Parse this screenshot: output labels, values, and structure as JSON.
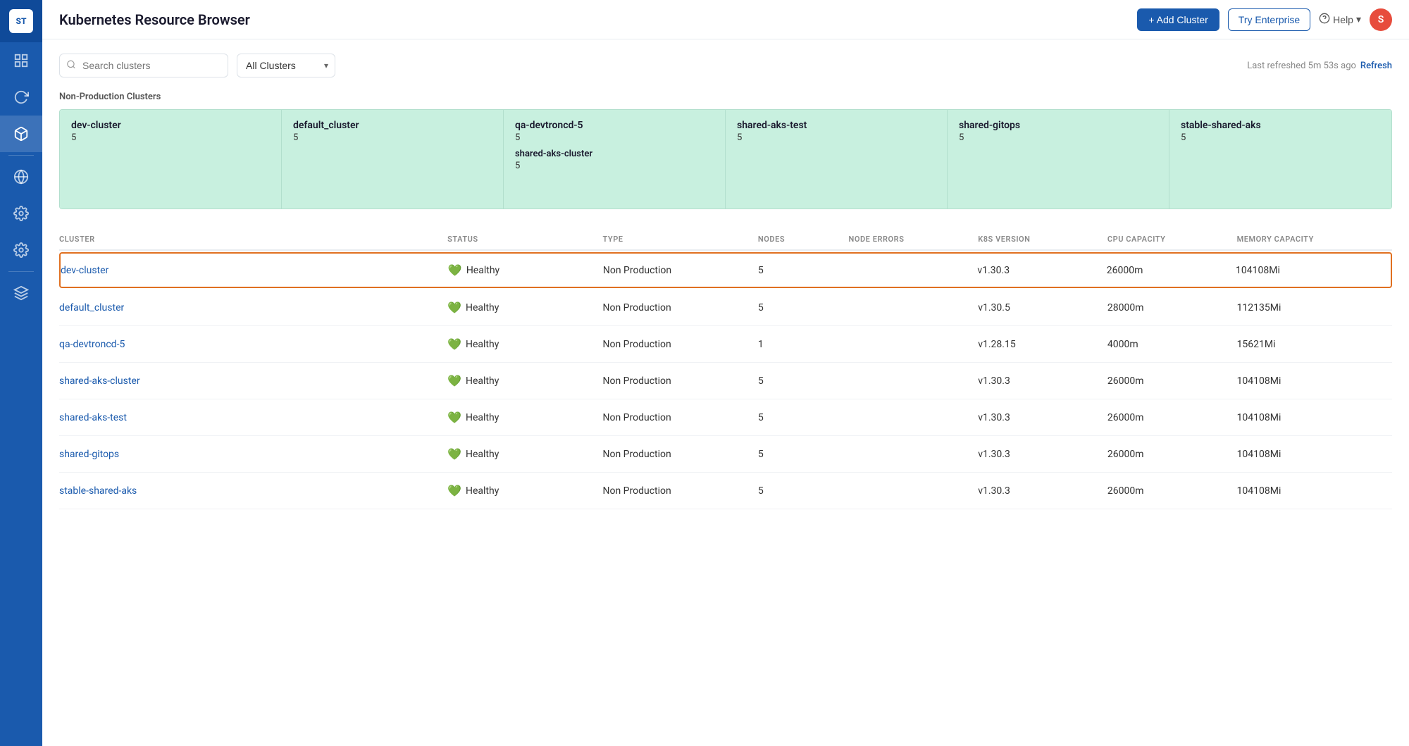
{
  "sidebar": {
    "logo": "ST",
    "items": [
      {
        "name": "dashboard",
        "icon": "grid",
        "active": false
      },
      {
        "name": "refresh",
        "icon": "refresh",
        "active": false
      },
      {
        "name": "kubernetes",
        "icon": "cube",
        "active": true
      },
      {
        "name": "globe",
        "icon": "globe",
        "active": false
      },
      {
        "name": "settings1",
        "icon": "gear",
        "active": false
      },
      {
        "name": "settings2",
        "icon": "gear2",
        "active": false
      },
      {
        "name": "layers",
        "icon": "layers",
        "active": false
      }
    ]
  },
  "header": {
    "title": "Kubernetes Resource Browser",
    "add_cluster_label": "+ Add Cluster",
    "try_enterprise_label": "Try Enterprise",
    "help_label": "Help",
    "avatar_label": "S"
  },
  "toolbar": {
    "search_placeholder": "Search clusters",
    "filter_label": "All Clusters",
    "refresh_info": "Last refreshed 5m 53s ago",
    "refresh_label": "Refresh"
  },
  "non_production": {
    "section_title": "Non-Production Clusters",
    "cards": [
      {
        "name": "dev-cluster",
        "count": "5",
        "sub_name": null,
        "sub_count": null
      },
      {
        "name": "default_cluster",
        "count": "5",
        "sub_name": null,
        "sub_count": null
      },
      {
        "name": "qa-devtroncd-5",
        "count": "5",
        "sub_name": "shared-aks-cluster",
        "sub_count": "5"
      },
      {
        "name": "shared-aks-test",
        "count": "5",
        "sub_name": null,
        "sub_count": null
      },
      {
        "name": "shared-gitops",
        "count": "5",
        "sub_name": null,
        "sub_count": null
      },
      {
        "name": "stable-shared-aks",
        "count": "5",
        "sub_name": null,
        "sub_count": null
      }
    ]
  },
  "table": {
    "columns": [
      "CLUSTER",
      "STATUS",
      "TYPE",
      "NODES",
      "NODE ERRORS",
      "K8S VERSION",
      "CPU CAPACITY",
      "MEMORY CAPACITY"
    ],
    "rows": [
      {
        "name": "dev-cluster",
        "status": "Healthy",
        "type": "Non Production",
        "nodes": "5",
        "node_errors": "",
        "k8s_version": "v1.30.3",
        "cpu_capacity": "26000m",
        "memory_capacity": "104108Mi",
        "selected": true
      },
      {
        "name": "default_cluster",
        "status": "Healthy",
        "type": "Non Production",
        "nodes": "5",
        "node_errors": "",
        "k8s_version": "v1.30.5",
        "cpu_capacity": "28000m",
        "memory_capacity": "112135Mi",
        "selected": false
      },
      {
        "name": "qa-devtroncd-5",
        "status": "Healthy",
        "type": "Non Production",
        "nodes": "1",
        "node_errors": "",
        "k8s_version": "v1.28.15",
        "cpu_capacity": "4000m",
        "memory_capacity": "15621Mi",
        "selected": false
      },
      {
        "name": "shared-aks-cluster",
        "status": "Healthy",
        "type": "Non Production",
        "nodes": "5",
        "node_errors": "",
        "k8s_version": "v1.30.3",
        "cpu_capacity": "26000m",
        "memory_capacity": "104108Mi",
        "selected": false
      },
      {
        "name": "shared-aks-test",
        "status": "Healthy",
        "type": "Non Production",
        "nodes": "5",
        "node_errors": "",
        "k8s_version": "v1.30.3",
        "cpu_capacity": "26000m",
        "memory_capacity": "104108Mi",
        "selected": false
      },
      {
        "name": "shared-gitops",
        "status": "Healthy",
        "type": "Non Production",
        "nodes": "5",
        "node_errors": "",
        "k8s_version": "v1.30.3",
        "cpu_capacity": "26000m",
        "memory_capacity": "104108Mi",
        "selected": false
      },
      {
        "name": "stable-shared-aks",
        "status": "Healthy",
        "type": "Non Production",
        "nodes": "5",
        "node_errors": "",
        "k8s_version": "v1.30.3",
        "cpu_capacity": "26000m",
        "memory_capacity": "104108Mi",
        "selected": false
      }
    ]
  },
  "colors": {
    "primary": "#1a5aad",
    "selected_border": "#e07020",
    "card_bg": "#c8f0df",
    "healthy_green": "#27ae60"
  }
}
